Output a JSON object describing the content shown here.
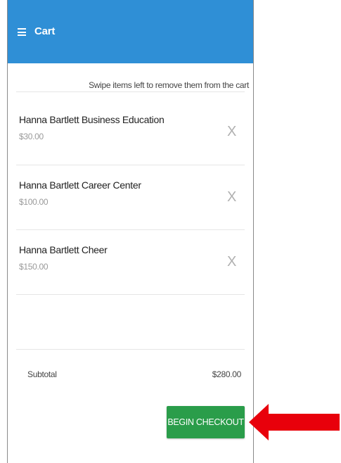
{
  "header": {
    "title": "Cart",
    "menu_icon": "hamburger-menu-icon",
    "color": "#2f8fd6"
  },
  "hint": "Swipe items left to remove them from the cart",
  "items": [
    {
      "name": "Hanna Bartlett Business Education",
      "price": "$30.00",
      "remove_label": "X"
    },
    {
      "name": "Hanna Bartlett Career Center",
      "price": "$100.00",
      "remove_label": "X"
    },
    {
      "name": "Hanna Bartlett Cheer",
      "price": "$150.00",
      "remove_label": "X"
    }
  ],
  "summary": {
    "subtotal_label": "Subtotal",
    "subtotal_value": "$280.00"
  },
  "checkout": {
    "label": "BEGIN CHECKOUT",
    "color": "#2a9d4a"
  },
  "annotation": {
    "arrow_color": "#e8000b"
  }
}
